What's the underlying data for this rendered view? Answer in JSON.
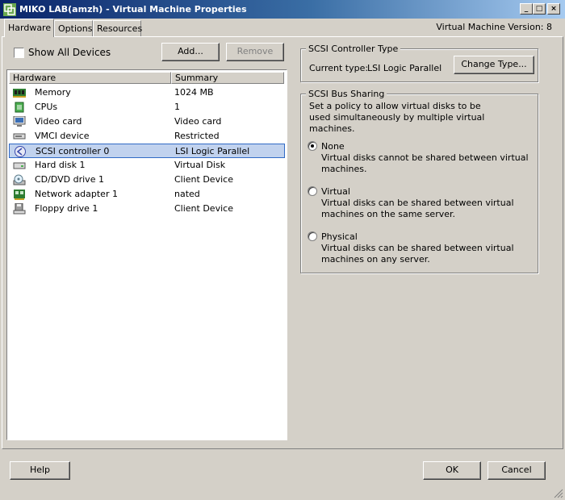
{
  "window": {
    "title": "MIKO LAB(amzh) - Virtual Machine Properties",
    "controls": {
      "minimize": "_",
      "maximize": "□",
      "close": "×"
    }
  },
  "tabs": [
    "Hardware",
    "Options",
    "Resources"
  ],
  "vm_version": "Virtual Machine Version: 8",
  "show_all_devices": {
    "label": "Show All Devices",
    "checked": false
  },
  "buttons": {
    "add": "Add...",
    "remove": "Remove",
    "help": "Help",
    "ok": "OK",
    "cancel": "Cancel",
    "change_type": "Change Type..."
  },
  "hardware_list": {
    "columns": [
      "Hardware",
      "Summary"
    ],
    "rows": [
      {
        "name": "Memory",
        "summary": "1024 MB",
        "icon": "memory-icon"
      },
      {
        "name": "CPUs",
        "summary": "1",
        "icon": "cpu-icon"
      },
      {
        "name": "Video card",
        "summary": "Video card",
        "icon": "monitor-icon"
      },
      {
        "name": "VMCI device",
        "summary": "Restricted",
        "icon": "vmci-device-icon"
      },
      {
        "name": "SCSI controller 0",
        "summary": "LSI Logic Parallel",
        "icon": "scsi-controller-icon",
        "selected": true
      },
      {
        "name": "Hard disk 1",
        "summary": "Virtual Disk",
        "icon": "hard-disk-icon"
      },
      {
        "name": "CD/DVD drive 1",
        "summary": "Client Device",
        "icon": "cd-dvd-icon"
      },
      {
        "name": "Network adapter 1",
        "summary": "nated",
        "icon": "network-adapter-icon"
      },
      {
        "name": "Floppy drive 1",
        "summary": "Client Device",
        "icon": "floppy-icon"
      }
    ]
  },
  "scsi_controller_type": {
    "title": "SCSI Controller Type",
    "current_label": "Current type:",
    "current_value": "LSI Logic Parallel"
  },
  "scsi_bus_sharing": {
    "title": "SCSI Bus Sharing",
    "description": "Set a policy to allow virtual disks to be used simultaneously by multiple virtual machines.",
    "options": [
      {
        "label": "None",
        "desc": "Virtual disks cannot be shared between virtual machines.",
        "checked": true
      },
      {
        "label": "Virtual",
        "desc": "Virtual disks can be shared between virtual machines on the same server.",
        "checked": false
      },
      {
        "label": "Physical",
        "desc": "Virtual disks can be shared between virtual machines on any server.",
        "checked": false
      }
    ]
  },
  "colors": {
    "selection_bg": "#c1d2ee",
    "selection_border": "#316ac5",
    "titlebar": "#0a246a"
  }
}
